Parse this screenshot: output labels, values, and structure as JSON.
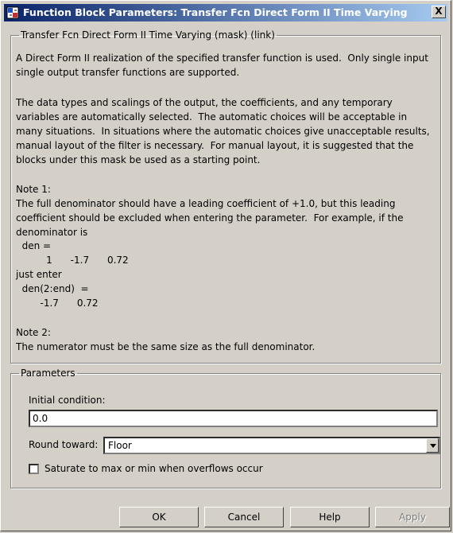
{
  "window": {
    "title": "Function Block Parameters: Transfer Fcn Direct Form II Time Varying",
    "close_label": "X"
  },
  "description": {
    "group_label": "Transfer Fcn Direct Form II Time Varying (mask) (link)",
    "lines": [
      "A Direct Form II realization of the specified transfer function is used.  Only single input",
      "single output transfer functions are supported.",
      "",
      "The data types and scalings of the output, the coefficients, and any temporary",
      "variables are automatically selected.  The automatic choices will be acceptable in",
      "many situations.  In situations where the automatic choices give unacceptable results,",
      "manual layout of the filter is necessary.  For manual layout, it is suggested that the",
      "blocks under this mask be used as a starting point.",
      "",
      "Note 1:",
      "The full denominator should have a leading coefficient of +1.0, but this leading",
      "coefficient should be excluded when entering the parameter.  For example, if the",
      "denominator is",
      "  den =",
      "          1      -1.7      0.72",
      "just enter",
      "  den(2:end)  =",
      "        -1.7      0.72",
      "",
      "Note 2:",
      "The numerator must be the same size as the full denominator."
    ]
  },
  "parameters": {
    "group_label": "Parameters",
    "initial_condition_label": "Initial condition:",
    "initial_condition_value": "0.0",
    "round_toward_label": "Round toward:",
    "round_toward_value": "Floor",
    "saturate_label": "Saturate to max or min when overflows occur"
  },
  "buttons": {
    "ok": "OK",
    "cancel": "Cancel",
    "help": "Help",
    "apply": "Apply"
  }
}
